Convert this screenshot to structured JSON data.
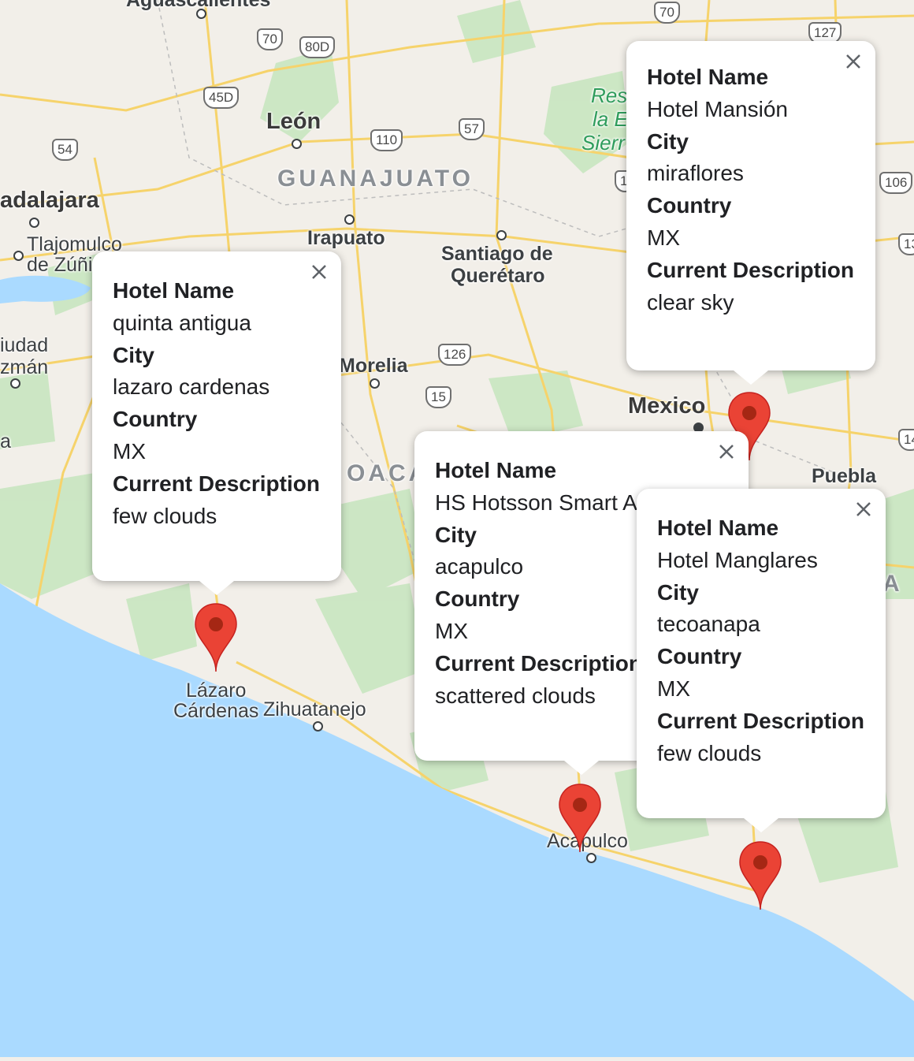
{
  "map": {
    "places": {
      "aguascalientes": "Aguascalientes",
      "leon": "León",
      "guanajuato": "GUANAJUATO",
      "guadalajara": "adalajara",
      "tlajomulco1": "Tlajomulco",
      "tlajomulco2": "de Zúñi",
      "irapuato": "Irapuato",
      "queretaro1": "Santiago de",
      "queretaro2": "Querétaro",
      "ciudad_guzman1": "iudad",
      "ciudad_guzman2": "zmán",
      "morelia": "Morelia",
      "mexico": "Mexico",
      "puebla": "Puebla",
      "michoacan": "OACA",
      "lazaro1": "Lázaro",
      "lazaro2": "Cárdenas",
      "zihuatanejo": "Zihuatanejo",
      "acapulco": "Acapulco",
      "reserve1": "Res",
      "reserve2": "la E",
      "reserve3": "Sierr",
      "left_a": "a",
      "right_a": "A"
    },
    "highways": [
      "70",
      "80D",
      "45D",
      "54",
      "110",
      "57",
      "70",
      "127",
      "106",
      "126",
      "15",
      "13",
      "14",
      "1"
    ]
  },
  "info_windows": [
    {
      "hotel_name_label": "Hotel Name",
      "hotel_name": "Hotel Mansión",
      "city_label": "City",
      "city": "miraflores",
      "country_label": "Country",
      "country": "MX",
      "description_label": "Current Description",
      "description": "clear sky"
    },
    {
      "hotel_name_label": "Hotel Name",
      "hotel_name": "quinta antigua",
      "city_label": "City",
      "city": "lazaro cardenas",
      "country_label": "Country",
      "country": "MX",
      "description_label": "Current Description",
      "description": "few clouds"
    },
    {
      "hotel_name_label": "Hotel Name",
      "hotel_name": "HS Hotsson Smart A",
      "city_label": "City",
      "city": "acapulco",
      "country_label": "Country",
      "country": "MX",
      "description_label": "Current Description",
      "description": "scattered clouds"
    },
    {
      "hotel_name_label": "Hotel Name",
      "hotel_name": "Hotel Manglares",
      "city_label": "City",
      "city": "tecoanapa",
      "country_label": "Country",
      "country": "MX",
      "description_label": "Current Description",
      "description": "few clouds"
    }
  ],
  "colors": {
    "land": "#f2efe9",
    "water": "#aadaff",
    "vegetation": "#c8e6c0",
    "roads": "#f6d36b",
    "marker": "#ea4335",
    "marker_dot": "#a52714"
  },
  "icons": {
    "marker": "map-pin-icon",
    "close": "close-icon"
  }
}
